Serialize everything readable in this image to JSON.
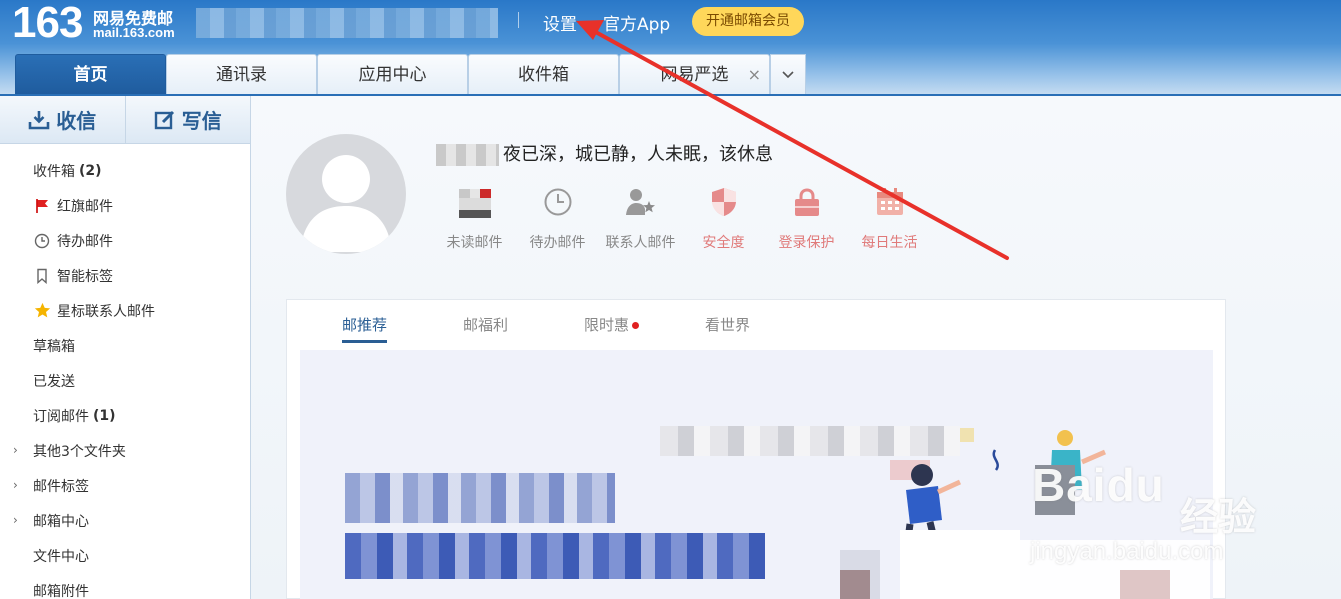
{
  "brand": {
    "logo_number": "163",
    "name_cn": "网易免费邮",
    "domain": "mail.163.com"
  },
  "topnav": {
    "settings": "设置",
    "app": "官方App",
    "vip": "开通邮箱会员"
  },
  "tabs": [
    {
      "label": "首页",
      "active": true
    },
    {
      "label": "通讯录"
    },
    {
      "label": "应用中心"
    },
    {
      "label": "收件箱"
    },
    {
      "label": "网易严选",
      "closable": true,
      "close": "×"
    }
  ],
  "tab_more_icon": "chevron-down-icon",
  "sidebar": {
    "receive": "收信",
    "compose": "写信",
    "folders": [
      {
        "label": "收件箱",
        "count": "(2)"
      },
      {
        "label": "红旗邮件",
        "icon": "red-flag-icon"
      },
      {
        "label": "待办邮件",
        "icon": "clock-icon"
      },
      {
        "label": "智能标签",
        "icon": "bookmark-icon"
      },
      {
        "label": "星标联系人邮件",
        "icon": "star-icon"
      },
      {
        "label": "草稿箱"
      },
      {
        "label": "已发送"
      },
      {
        "label": "订阅邮件",
        "count": "(1)"
      },
      {
        "label": "其他3个文件夹",
        "expandable": true
      },
      {
        "label": "邮件标签",
        "expandable": true
      },
      {
        "label": "邮箱中心",
        "expandable": true
      },
      {
        "label": "文件中心"
      },
      {
        "label": "邮箱附件"
      }
    ]
  },
  "main": {
    "greeting": "夜已深，城已静，人未眠，该休息",
    "quick": [
      {
        "label": "未读邮件",
        "icon": "unread-mail-icon"
      },
      {
        "label": "待办邮件",
        "icon": "clock-icon"
      },
      {
        "label": "联系人邮件",
        "icon": "contact-star-icon"
      },
      {
        "label": "安全度",
        "icon": "shield-icon"
      },
      {
        "label": "登录保护",
        "icon": "lock-icon"
      },
      {
        "label": "每日生活",
        "icon": "calendar-icon"
      }
    ],
    "feed_tabs": [
      {
        "label": "邮推荐",
        "active": true
      },
      {
        "label": "邮福利"
      },
      {
        "label": "限时惠",
        "dot": true
      },
      {
        "label": "看世界"
      }
    ]
  },
  "watermark": {
    "main": "Baidu",
    "cn": "经验",
    "sub": "jingyan.baidu.com"
  },
  "colors": {
    "header_blue": "#2a78c8",
    "active_tab": "#1f5c9e",
    "vip_yellow": "#ffd75a",
    "annotation_red": "#e8312a"
  }
}
